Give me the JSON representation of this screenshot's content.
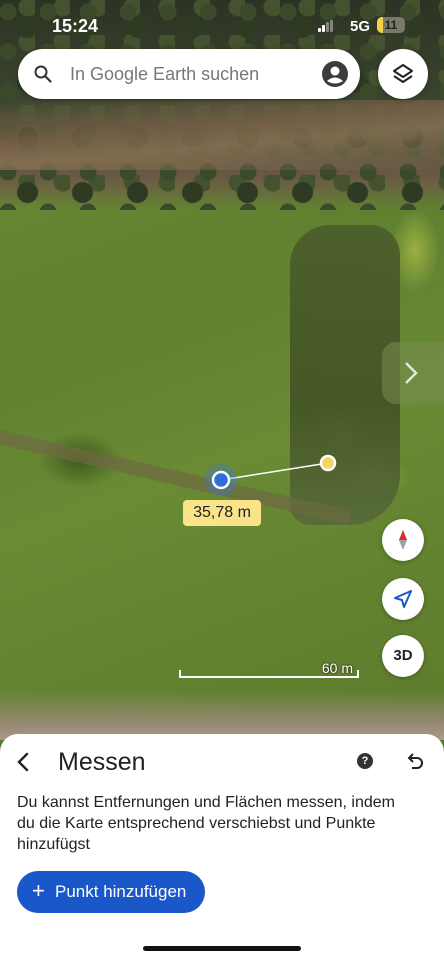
{
  "status_bar": {
    "time": "15:24",
    "network": "5G",
    "battery": "11"
  },
  "search": {
    "placeholder": "In Google Earth suchen"
  },
  "map": {
    "distance": "35,78 m",
    "scale": "60 m",
    "btn_3d": "3D"
  },
  "sheet": {
    "title": "Messen",
    "description": "Du kannst Entfernungen und Flächen messen, indem du die Karte entsprechend verschiebst und Punkte hinzufügst",
    "add_button": "Punkt hinzufügen",
    "help": "?"
  },
  "colors": {
    "accent": "#1a57c9",
    "label": "#fbe38a",
    "point": "#f4d35e"
  }
}
